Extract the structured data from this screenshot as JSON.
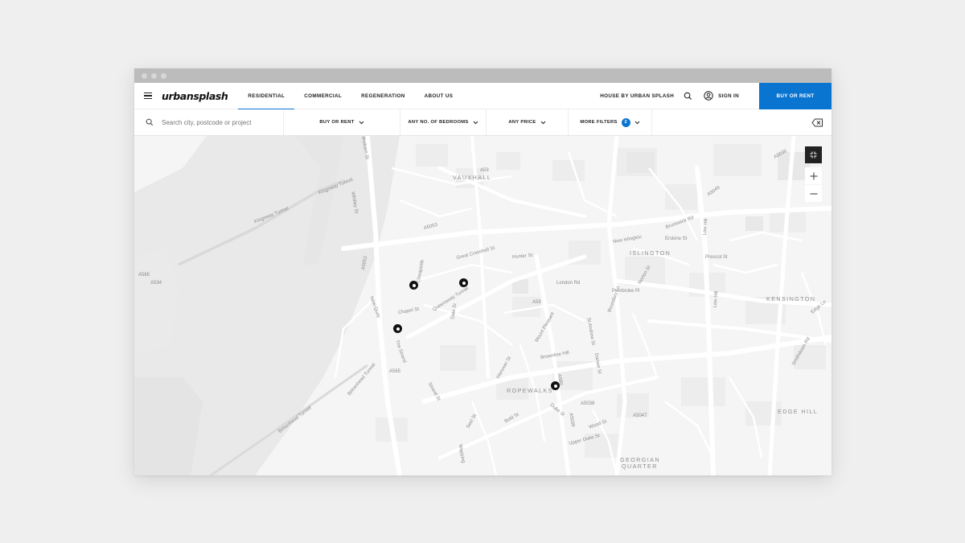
{
  "nav": {
    "logo": "urbansplash",
    "links": [
      "RESIDENTIAL",
      "COMMERCIAL",
      "REGENERATION",
      "ABOUT US"
    ],
    "active_link": "RESIDENTIAL",
    "house_link": "HOUSE BY URBAN SPLASH",
    "sign_in": "SIGN IN",
    "cta": "BUY OR RENT"
  },
  "filters": {
    "search_placeholder": "Search city, postcode or project",
    "buy_or_rent": "BUY OR RENT",
    "bedrooms": "ANY NO. OF BEDROOMS",
    "price": "ANY PRICE",
    "more_filters": "MORE FILTERS",
    "more_filters_count": "2"
  },
  "map": {
    "districts": [
      "VAUXHALL",
      "ISLINGTON",
      "KENSINGTON",
      "ROPEWALKS",
      "EDGE HILL",
      "GEORGIAN",
      "QUARTER"
    ],
    "streets": [
      "Kingsway Tunnel",
      "Queensway Tunnel",
      "Birkenhead Tunnel",
      "Hunter St",
      "Great Crosshall St",
      "New Islington",
      "Erskine St",
      "Brunswick Rd",
      "Low Hill",
      "Prescot St",
      "Pembroke Pl",
      "London Rd",
      "Norton St",
      "New Quay",
      "The Strand",
      "Strand St",
      "Hanover St",
      "Duke St",
      "Bold St",
      "Seel St",
      "Wapping",
      "Upper Duke St",
      "Wood St",
      "Dansie St",
      "Mount Pleasant",
      "Brownlow Hill",
      "St Andrew St",
      "Boundary Ln",
      "Cheapside",
      "Dale St",
      "Edge Ln",
      "Smithdown Rd",
      "Tithebarn St",
      "Chapel St",
      "Whitley St"
    ],
    "roads": [
      "A59",
      "A5053",
      "A5049",
      "A5036",
      "A5052",
      "A565",
      "A580",
      "A5047",
      "A5038",
      "A5039",
      "A534"
    ],
    "pin_count": 4
  }
}
